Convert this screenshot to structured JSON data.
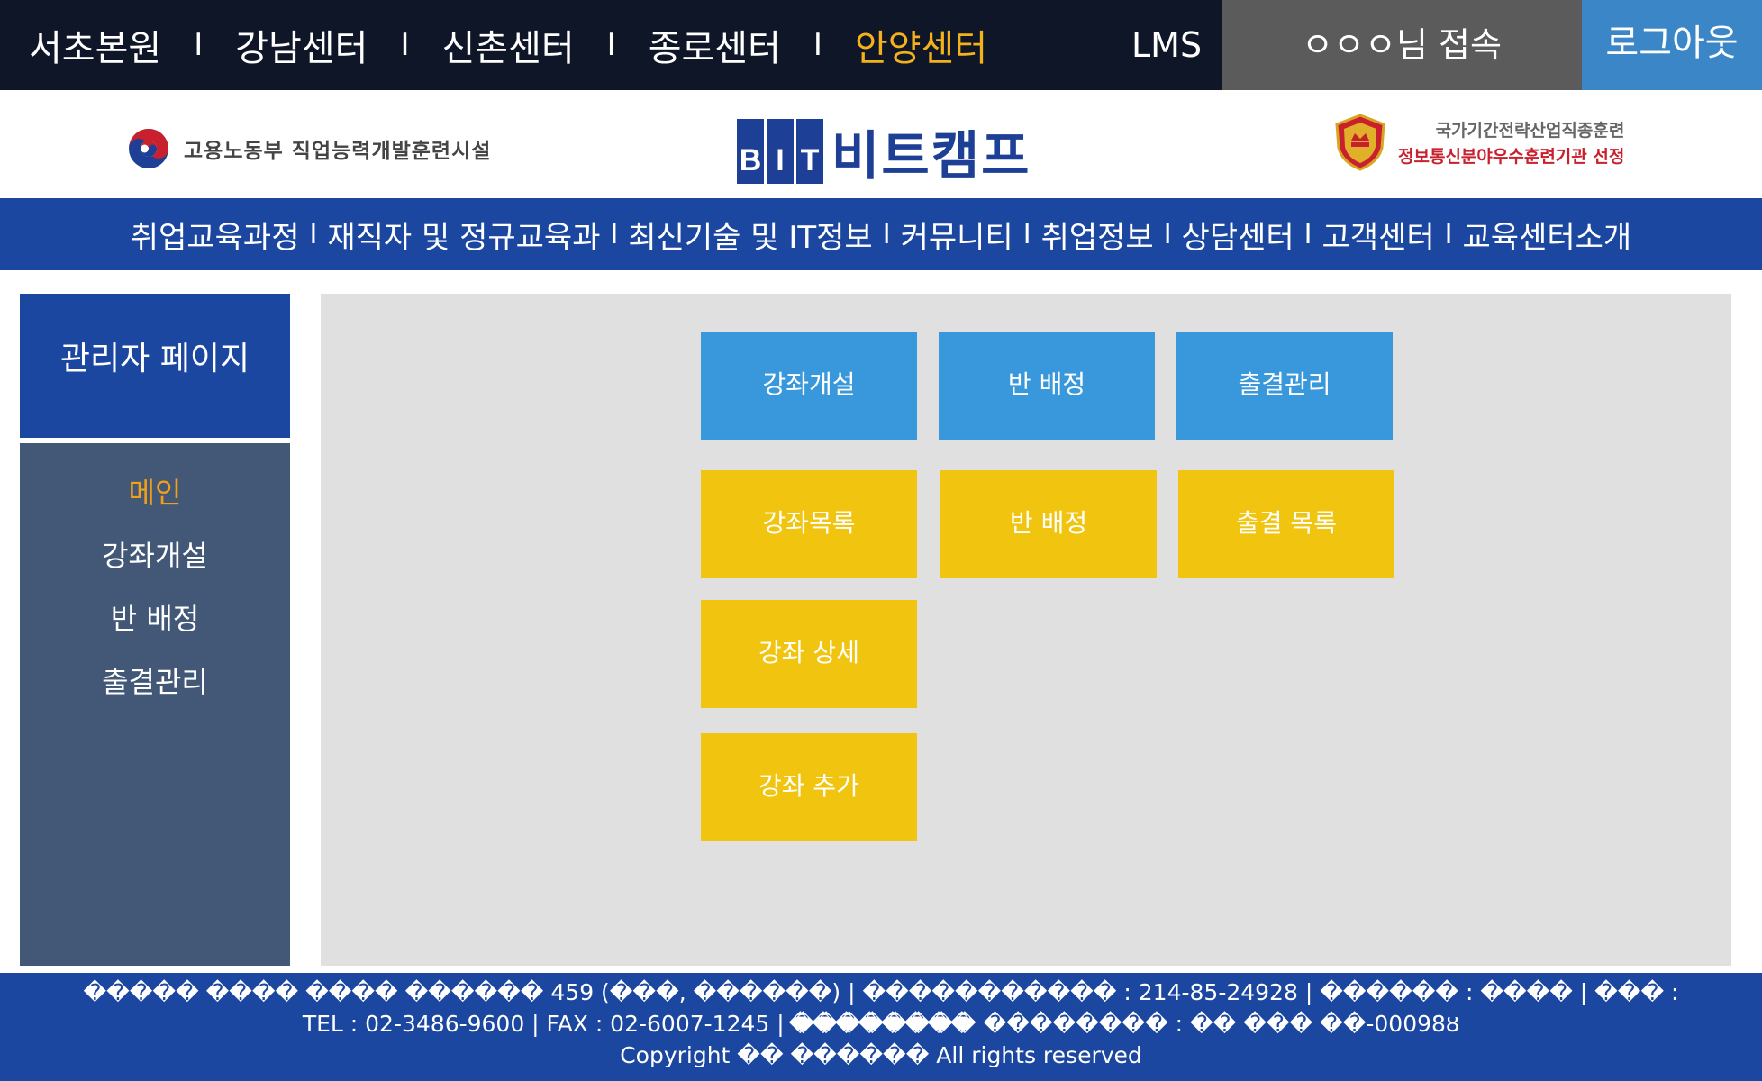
{
  "top_bar": {
    "centers": [
      {
        "label": "서초본원",
        "active": false
      },
      {
        "label": "강남센터",
        "active": false
      },
      {
        "label": "신촌센터",
        "active": false
      },
      {
        "label": "종로센터",
        "active": false
      },
      {
        "label": "안양센터",
        "active": true
      }
    ],
    "separator": "I",
    "lms": "LMS",
    "user_status": "ㅇㅇㅇ님 접속",
    "logout": "로그아웃"
  },
  "logos": {
    "gov_text": "고용노동부 직업능력개발훈련시설",
    "bit_letters": [
      "B",
      "I",
      "T"
    ],
    "bit_name": "비트캠프",
    "award_line1": "국가기간전략산업직종훈련",
    "award_line2": "정보통신분야우수훈련기관 선정"
  },
  "main_nav": {
    "items": [
      "취업교육과정",
      "재직자 및 정규교육과",
      "최신기술 및 IT정보",
      "커뮤니티",
      "취업정보",
      "상담센터",
      "고객센터",
      "교육센터소개"
    ],
    "separator": "I"
  },
  "sidebar": {
    "title": "관리자 페이지",
    "items": [
      {
        "label": "메인",
        "active": true
      },
      {
        "label": "강좌개설",
        "active": false
      },
      {
        "label": "반 배정",
        "active": false
      },
      {
        "label": "출결관리",
        "active": false
      }
    ]
  },
  "tiles": {
    "t1": "강좌개설",
    "t2": "반 배정",
    "t3": "출결관리",
    "t4": "강좌목록",
    "t5": "반 배정",
    "t6": "출결 목록",
    "t7": "강좌 상세",
    "t8": "강좌 추가"
  },
  "footer": {
    "line1": "����� ���� ���� ������ 459 (���, ������) | ����������� : 214-85-24928 | ������ : ���� | ��� : ��������",
    "line2": "TEL : 02-3486-9600 | FAX : 02-6007-1245 | �������� �������� : �� ��� ��-00098ȣ",
    "line3": "Copyright �� ������ All rights reserved"
  },
  "colors": {
    "top_bar": "#0f1628",
    "active_center": "#f3b21b",
    "user_box": "#5b5b5b",
    "logout": "#3a86c6",
    "brand_blue": "#1c47a0",
    "sidebar_menu": "#435877",
    "tile_blue": "#3898db",
    "tile_yellow": "#f1c40f",
    "award_red": "#c8202d"
  },
  "icons": {
    "gov_emblem": "taegeuk-emblem-icon",
    "award": "shield-award-icon"
  }
}
